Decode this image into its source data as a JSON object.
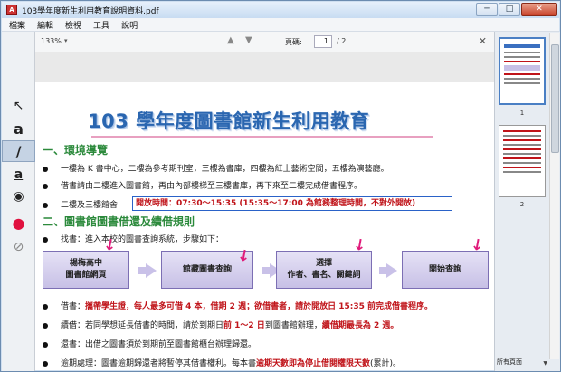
{
  "window": {
    "title": "103學年度新生利用教育說明資料.pdf",
    "app_icon_text": "A",
    "minimize": "─",
    "maximize": "□",
    "close": "✕"
  },
  "menu": [
    "檔案",
    "編輯",
    "檢視",
    "工具",
    "說明"
  ],
  "toolbar": {
    "zoom": "133%",
    "zoom_arrow": "▾",
    "prev": "▲",
    "next": "▼",
    "page_label": "頁碼:",
    "page_value": "1",
    "page_total": "/ 2",
    "close": "✕"
  },
  "tools": {
    "arrow": "↖",
    "text": "a",
    "pen": "/",
    "textbox": "a",
    "eye": "◉",
    "color": "●",
    "eraser": "⊘"
  },
  "document": {
    "title": "103 學年度圖書館新生利用教育",
    "section1": "一、環境導覽",
    "s1_line1": "一樓為 K 書中心，二樓為參考期刊室，三樓為書庫，四樓為紅土藝術空間，五樓為演藝廳。",
    "s1_line2": "借書請由二樓進入圖書館，再由內部樓梯至三樓書庫，再下來至二樓完成借書程序。",
    "s1_line3_prefix": "二樓及三樓館舍",
    "open_hours": "開放時間：07:30～15:35 (15:35～17:00 為館務整理時間，不對外開放)",
    "section2": "二、圖書館圖書借還及續借規則",
    "s2_intro": "找書：進入本校的圖書查詢系統，步驟如下：",
    "flow": [
      {
        "line1": "楊梅高中",
        "line2": "圖書館網頁"
      },
      {
        "line1": "館藏圖書查詢",
        "line2": ""
      },
      {
        "line1": "選擇",
        "line2": "作者、書名、關鍵詞"
      },
      {
        "line1": "開始查詢",
        "line2": ""
      }
    ],
    "borrow_prefix": "借書：",
    "borrow_red": "攜帶學生證，每人最多可借 4 本，借期 2 週；欲借書者，請於開放日 15:35 前完成借書程序。",
    "renew_prefix": "續借：若同學想延長借書的時間，請於到期日",
    "renew_red1": "前 1～2 日",
    "renew_mid": "到圖書館辦理，",
    "renew_red2": "續借期最長為 2 週。",
    "return_text": "還書：出借之圖書須於到期前至圖書館櫃台辦理歸還。",
    "overdue_prefix": "逾期處理：圖書逾期歸還者將暫停其借書權利。每本書",
    "overdue_red": "逾期天數即為停止借閱權限天數",
    "overdue_suffix": "(累計)。"
  },
  "thumbnails": {
    "page1": "1",
    "page2": "2",
    "footer": "所有頁面"
  },
  "colors": {
    "title_blue": "#2a66b0",
    "section_green": "#2c8a3c",
    "emphasis_red": "#c0141a",
    "annotation_pink": "#e01a7a",
    "highlight_box": "#2a62c8"
  }
}
